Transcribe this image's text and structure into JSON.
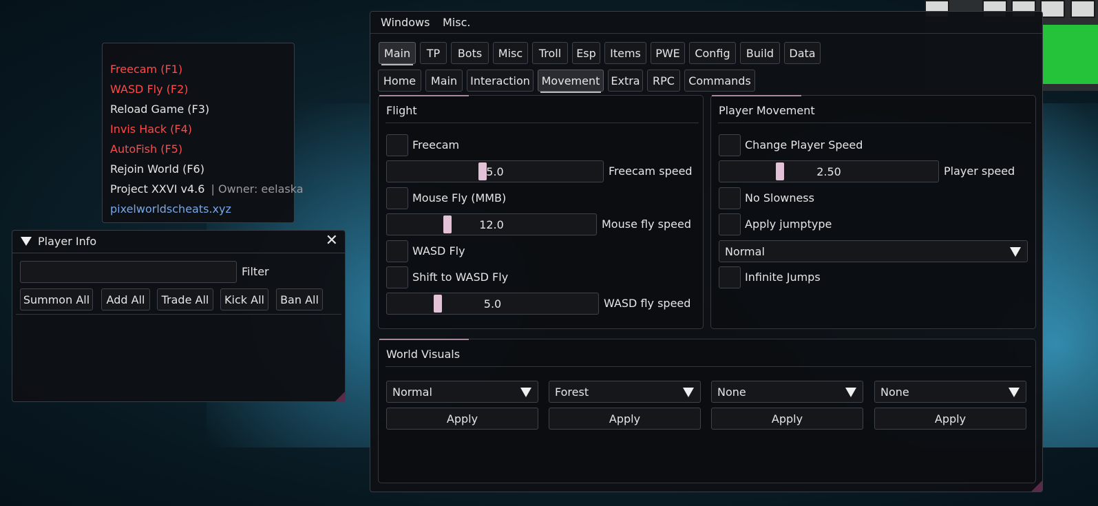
{
  "overlay": {
    "lines": [
      {
        "text": "Freecam (F1)",
        "color": "#ff4a4a"
      },
      {
        "text": "WASD Fly (F2)",
        "color": "#ff4a4a"
      },
      {
        "text": "Reload Game (F3)",
        "color": "#e6e6e6"
      },
      {
        "text": "Invis Hack (F4)",
        "color": "#ff4a4a"
      },
      {
        "text": "AutoFish (F5)",
        "color": "#ff4a4a"
      },
      {
        "text": "Rejoin World (F6)",
        "color": "#e6e6e6"
      }
    ],
    "version": "Project XXVI v4.6",
    "owner": "| Owner: eelaska",
    "site": "pixelworldscheats.xyz"
  },
  "player_info": {
    "title": "Player Info",
    "close_glyph": "✕",
    "filter_label": "Filter",
    "filter_value": "",
    "filter_placeholder": "",
    "buttons": [
      "Summon All",
      "Add All",
      "Trade All",
      "Kick All",
      "Ban All"
    ]
  },
  "main_window": {
    "menu": [
      "Windows",
      "Misc."
    ],
    "tabs": [
      "Main",
      "TP",
      "Bots",
      "Misc",
      "Troll",
      "Esp",
      "Items",
      "PWE",
      "Config",
      "Build",
      "Data"
    ],
    "active_tab": "Main",
    "subtabs": [
      "Home",
      "Main",
      "Interaction",
      "Movement",
      "Extra",
      "RPC",
      "Commands"
    ],
    "active_subtab": "Movement",
    "flight": {
      "title": "Flight",
      "freecam_label": "Freecam",
      "freecam_checked": false,
      "freecam_speed_value": "5.0",
      "freecam_speed_label": "Freecam speed",
      "mouse_fly_label": "Mouse Fly (MMB)",
      "mouse_fly_checked": false,
      "mouse_fly_speed_value": "12.0",
      "mouse_fly_speed_label": "Mouse fly speed",
      "wasd_fly_label": "WASD Fly",
      "wasd_fly_checked": false,
      "shift_wasd_label": "Shift to WASD Fly",
      "shift_wasd_checked": false,
      "wasd_speed_value": "5.0",
      "wasd_speed_label": "WASD fly speed"
    },
    "player_movement": {
      "title": "Player Movement",
      "change_speed_label": "Change Player Speed",
      "change_speed_checked": false,
      "player_speed_value": "2.50",
      "player_speed_label": "Player speed",
      "no_slowness_label": "No Slowness",
      "no_slowness_checked": false,
      "apply_jumptype_label": "Apply jumptype",
      "apply_jumptype_checked": false,
      "jumptype_value": "Normal",
      "infinite_jumps_label": "Infinite Jumps",
      "infinite_jumps_checked": false
    },
    "world_visuals": {
      "title": "World Visuals",
      "combos": [
        "Normal",
        "Forest",
        "None",
        "None"
      ],
      "apply_label": "Apply"
    }
  },
  "colors": {
    "active_text_red": "#ff4a4a",
    "link_blue": "#78a8e8",
    "slider_grab": "#e3c2d8",
    "accent_green": "#25c33a"
  }
}
